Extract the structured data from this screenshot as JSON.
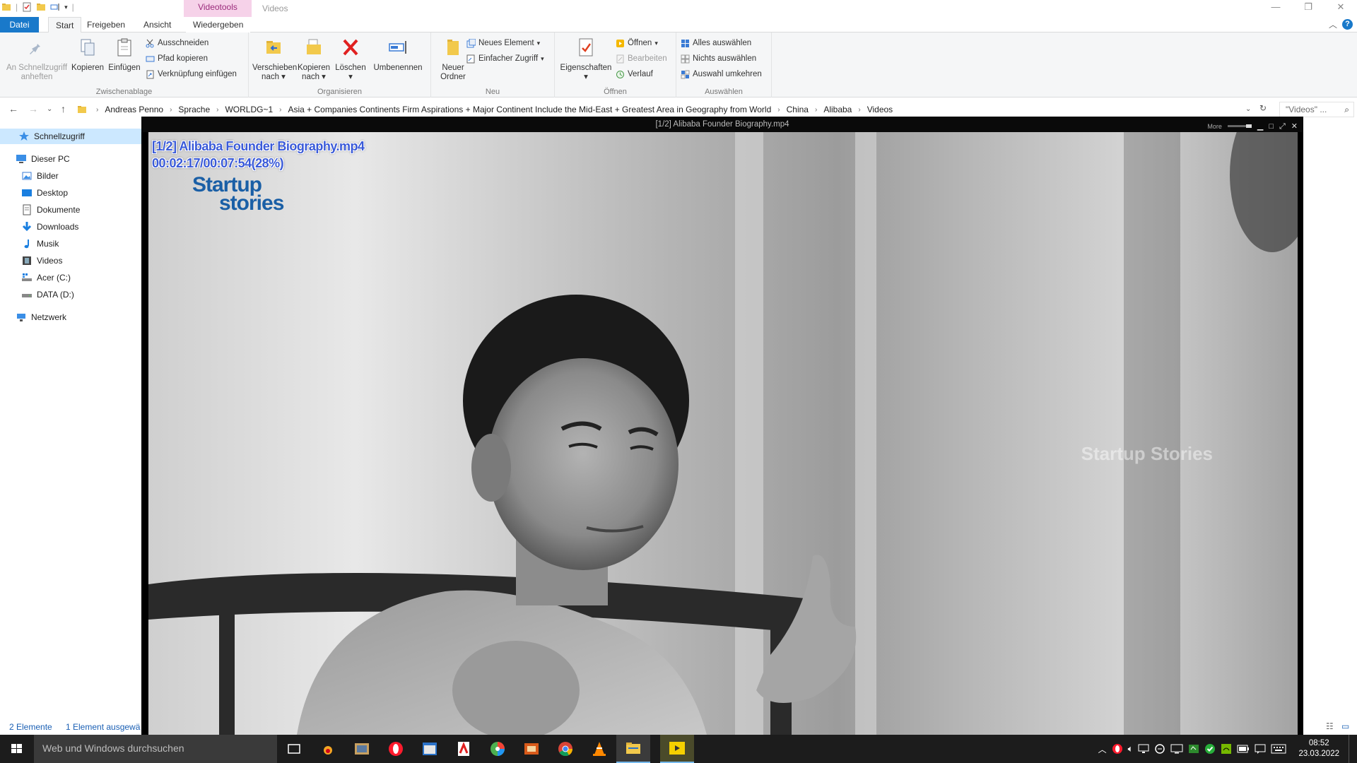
{
  "titlebar": {
    "context_tab": "Videotools",
    "title": "Videos"
  },
  "ribbon_tabs": {
    "datei": "Datei",
    "start": "Start",
    "freigeben": "Freigeben",
    "ansicht": "Ansicht",
    "wiedergeben": "Wiedergeben"
  },
  "ribbon": {
    "clipboard": {
      "label": "Zwischenablage",
      "pin_line1": "An Schnellzugriff",
      "pin_line2": "anheften",
      "copy": "Kopieren",
      "paste": "Einfügen",
      "cut": "Ausschneiden",
      "copy_path": "Pfad kopieren",
      "paste_shortcut": "Verknüpfung einfügen"
    },
    "organize": {
      "label": "Organisieren",
      "move_line1": "Verschieben",
      "move_line2": "nach",
      "copyto_line1": "Kopieren",
      "copyto_line2": "nach",
      "delete": "Löschen",
      "rename": "Umbenennen"
    },
    "new": {
      "label": "Neu",
      "folder_line1": "Neuer",
      "folder_line2": "Ordner",
      "new_item": "Neues Element",
      "easy_access": "Einfacher Zugriff"
    },
    "open": {
      "label": "Öffnen",
      "properties": "Eigenschaften",
      "open": "Öffnen",
      "edit": "Bearbeiten",
      "history": "Verlauf"
    },
    "select": {
      "label": "Auswählen",
      "select_all": "Alles auswählen",
      "select_none": "Nichts auswählen",
      "invert": "Auswahl umkehren"
    }
  },
  "address": {
    "crumbs": [
      "Andreas Penno",
      "Sprache",
      "WORLDG~1",
      "Asia + Companies  Continents Firm Aspirations + Major Continent Include the Mid-East + Greatest Area in Geography from World",
      "China",
      "Alibaba",
      "Videos"
    ],
    "search_placeholder": "\"Videos\" ..."
  },
  "navpane": {
    "quick_access": "Schnellzugriff",
    "this_pc": "Dieser PC",
    "pictures": "Bilder",
    "desktop": "Desktop",
    "documents": "Dokumente",
    "downloads": "Downloads",
    "music": "Musik",
    "videos": "Videos",
    "drive_c": "Acer (C:)",
    "drive_d": "DATA (D:)",
    "network": "Netzwerk"
  },
  "statusbar": {
    "count": "2 Elemente",
    "selected": "1 Element ausgewä"
  },
  "player": {
    "window_title": "[1/2] Alibaba Founder Biography.mp4",
    "more": "More",
    "osd_title": "[1/2] Alibaba Founder Biography.mp4",
    "osd_time": "00:02:17/00:07:54(28%)",
    "progress_percent": 28,
    "logo_line1": "Startup",
    "logo_line2": "stories",
    "watermark": "Startup Stories"
  },
  "taskbar": {
    "search_placeholder": "Web und Windows durchsuchen",
    "time": "08:52",
    "date": "23.03.2022"
  }
}
